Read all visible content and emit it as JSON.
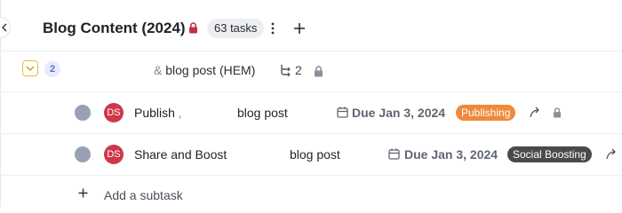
{
  "header": {
    "title": "Blog Content (2024)",
    "task_count": "63 tasks"
  },
  "group": {
    "subtask_badge": "2",
    "title": " blog post (HEM)",
    "title_prefix": "&",
    "subtask_count": "2"
  },
  "tasks": [
    {
      "assignee_initials": "DS",
      "name_part1": "Publish",
      "name_part2": "blog post",
      "due": "Due Jan 3, 2024",
      "tag": "Publishing",
      "tag_color": "#ef8a3b"
    },
    {
      "assignee_initials": "DS",
      "name_part1": "Share and Boost",
      "name_part2": "blog post",
      "due": "Due Jan 3, 2024",
      "tag": "Social Boosting",
      "tag_color": "#4a4a4a"
    }
  ],
  "add_subtask": "Add a subtask",
  "colors": {
    "lock_red": "#c0304a",
    "accent_chevron": "#e8b84a"
  }
}
